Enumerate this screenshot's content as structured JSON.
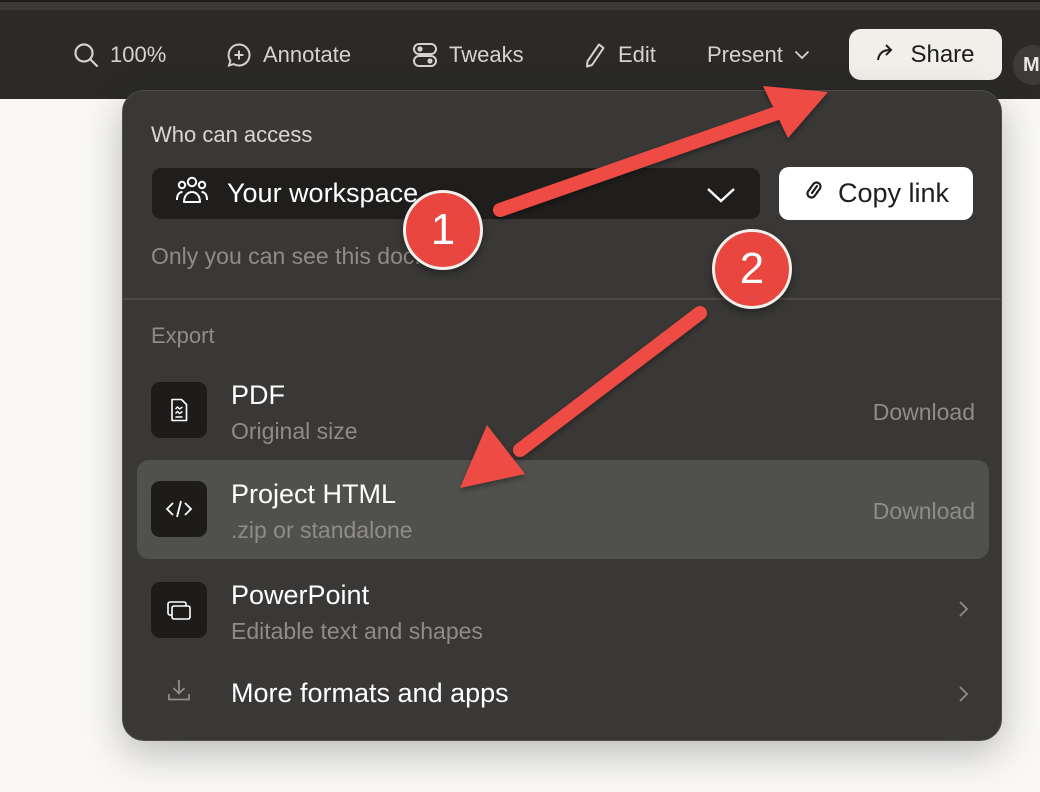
{
  "toolbar": {
    "zoom": "100%",
    "annotate": "Annotate",
    "tweaks": "Tweaks",
    "edit": "Edit",
    "present": "Present",
    "share": "Share",
    "avatar_initial": "M"
  },
  "share_popover": {
    "access_label": "Who can access",
    "workspace_value": "Your workspace",
    "copy_link": "Copy link",
    "access_note": "Only you can see this doc.",
    "export_label": "Export",
    "export_items": [
      {
        "title": "PDF",
        "subtitle": "Original size",
        "action": "Download",
        "icon": "document-icon"
      },
      {
        "title": "Project HTML",
        "subtitle": ".zip or standalone",
        "action": "Download",
        "icon": "code-icon"
      },
      {
        "title": "PowerPoint",
        "subtitle": "Editable text and shapes",
        "action": "",
        "icon": "slides-icon"
      },
      {
        "title": "More formats and apps",
        "subtitle": "",
        "action": "",
        "icon": "download-icon"
      }
    ]
  },
  "annotations": {
    "badge_1": "1",
    "badge_2": "2",
    "color": "#e8463f"
  }
}
